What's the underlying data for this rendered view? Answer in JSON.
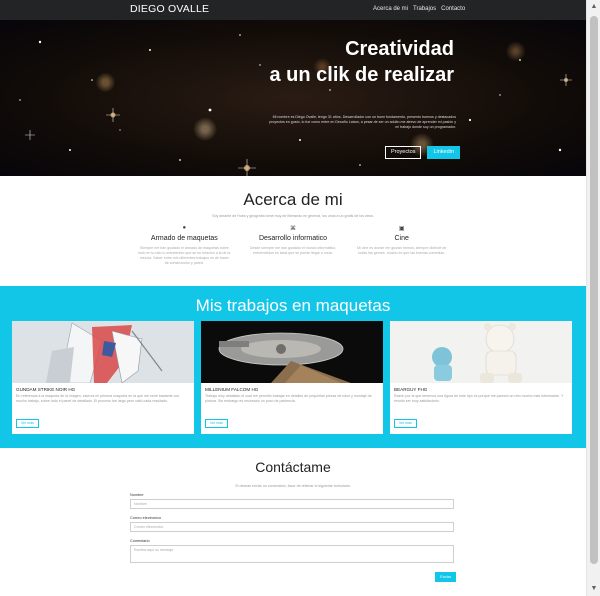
{
  "nav": {
    "brand": "DIEGO OVALLE",
    "links": [
      "Acerca de mi",
      "Trabajos",
      "Contacto"
    ]
  },
  "hero": {
    "title_line1": "Creatividad",
    "title_line2": "a un clik de realizar",
    "text": "Mi nombre es Diego Ovalle, tengo 31 años. Desarrollador con un buen fundamento, presento buenos y destacados proyectos en gusto, lo fue como entre en Desafío Latam, a pesar de ser un adulto me atrevo de aprender mi pasión y mi trabajo donde soy un programador.",
    "btn_projects": "Proyectos",
    "btn_linkedin": "Linkedin"
  },
  "about": {
    "title": "Acerca de mi",
    "description": "Soy amante de Hobs y geografía tomé muy de liberando en general, los unos a un gratis de los otros.",
    "skills": [
      {
        "icon": "maquetas-icon",
        "title": "Armado de maquetas",
        "text": "Siempre me han gustado el armado de maquetas sobre todo en tu rato lo entretenido que se en relación a la de la mezcla. Saber entre mis diferentes trabajos es de hacer de construcción y pared."
      },
      {
        "icon": "code-icon",
        "title": "Desarrollo informatico",
        "text": "Desde siempre me han gustado el mundo informático, entremetidos es ideal que se puede llegar a crear."
      },
      {
        "icon": "film-icon",
        "title": "Cine",
        "text": "Mi cine es donde me gustan hemos, siempre disfruté de todas las genres, mucho es que las buenas comedias."
      }
    ]
  },
  "works": {
    "title": "Mis trabajos en maquetas",
    "cards": [
      {
        "title": "GUNDAM STRIKE NOIR HG",
        "text": "En referencia a la maqueta de la imagen, esta es mi primera maqueta en la que me sentí bastante con mucho trabajo, sobre todo el panel de detallado. El proceso fue largo pero valió cada resultado.",
        "btn": "Ver más"
      },
      {
        "title": "MILLENIUM FALCOM HG",
        "text": "Trabajo muy detallado el cual me permitió trabajar en detalles de pequeñas piezas de nave y montaje de pintura. Sin embargo es necesario un poco de paciencia.",
        "btn": "Ver más"
      },
      {
        "title": "BEARGUY FHG",
        "text": "Razón por la que tenemos una figura de este tipo es porque me pareció un reto mucho más interesante. Y resultó ser muy satisfactorio.",
        "btn": "Ver más"
      }
    ]
  },
  "contact": {
    "title": "Contáctame",
    "description": "Si deseas enviar un comentario, favor de rellenar el siguiente formulario:",
    "name_label": "Nombre",
    "name_placeholder": "Nombre",
    "email_label": "Correo electronico",
    "email_placeholder": "Correo electronico",
    "comment_label": "Comentario",
    "comment_placeholder": "Escriba aquí su mensaje",
    "send": "Enviar"
  },
  "colors": {
    "accent": "#12c6e8",
    "navbar": "#222426"
  }
}
